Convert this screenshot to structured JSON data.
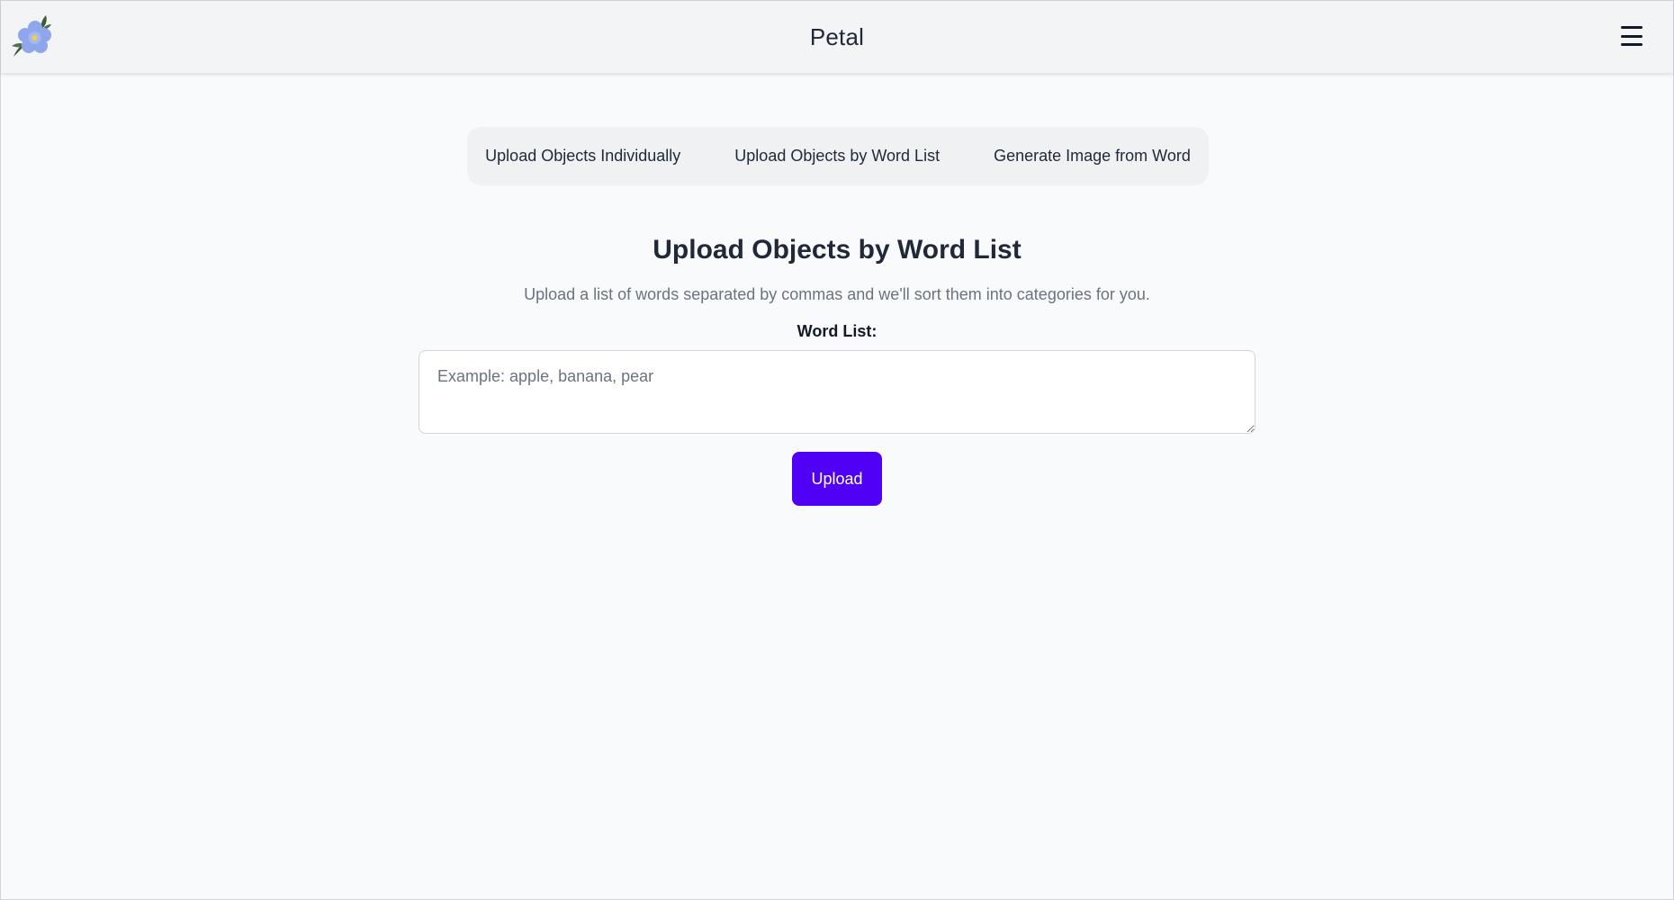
{
  "header": {
    "app_title": "Petal",
    "logo_icon": "flower-logo-icon",
    "menu_icon": "hamburger-menu-icon"
  },
  "tabs": [
    {
      "label": "Upload Objects Individually"
    },
    {
      "label": "Upload Objects by Word List"
    },
    {
      "label": "Generate Image from Word"
    }
  ],
  "main": {
    "title": "Upload Objects by Word List",
    "description": "Upload a list of words separated by commas and we'll sort them into categories for you.",
    "field_label": "Word List:",
    "textarea_placeholder": "Example: apple, banana, pear",
    "textarea_value": "",
    "upload_label": "Upload"
  },
  "colors": {
    "accent": "#4f00f5",
    "background": "#f9fafb",
    "header_bg": "#f3f4f6",
    "tab_bar_bg": "#f0f1f3",
    "flower": "#8fa6ec",
    "leaf": "#3f5a3a"
  }
}
